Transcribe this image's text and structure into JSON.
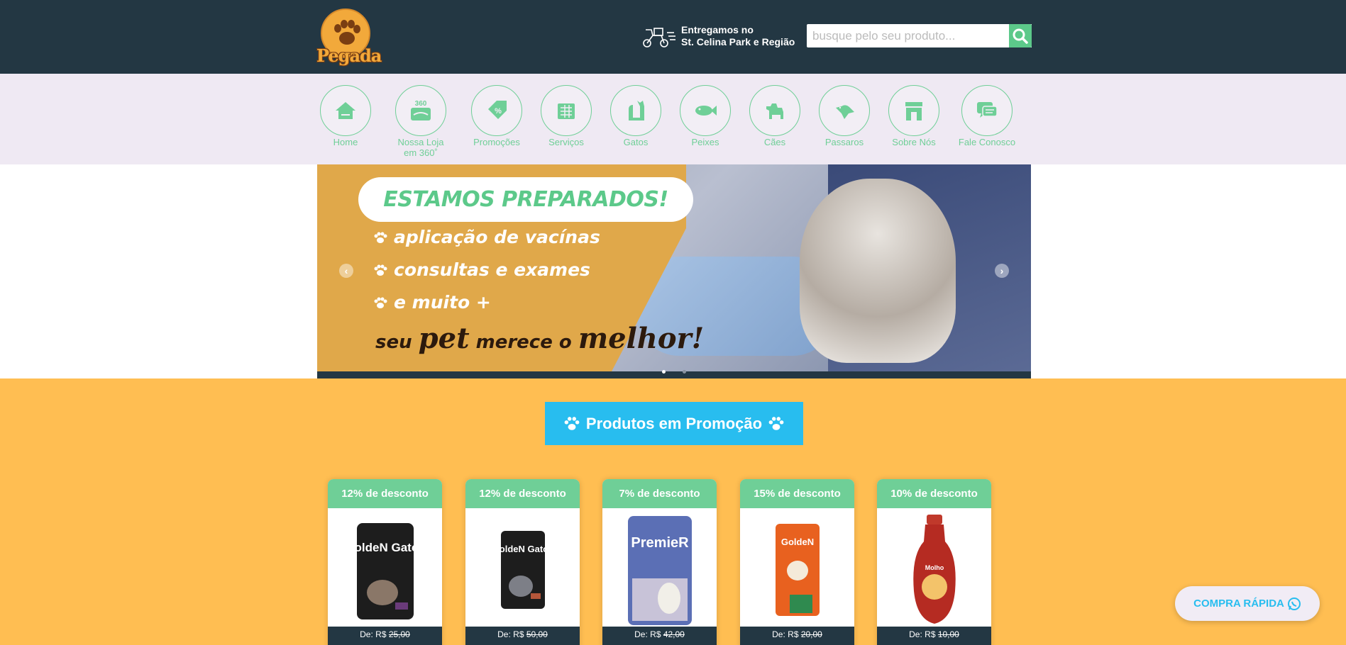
{
  "header": {
    "logo_text": "Pegada",
    "delivery_line1": "Entregamos no",
    "delivery_line2": "St. Celina Park e Região",
    "search_placeholder": "busque pelo seu produto..."
  },
  "nav": {
    "items": [
      {
        "label": "Home",
        "icon": "house-icon"
      },
      {
        "label": "Nossa Loja em 360˚",
        "icon": "store-360-icon"
      },
      {
        "label": "Promoções",
        "icon": "discount-tag-icon"
      },
      {
        "label": "Serviços",
        "icon": "services-icon"
      },
      {
        "label": "Gatos",
        "icon": "cat-icon"
      },
      {
        "label": "Peixes",
        "icon": "fish-icon"
      },
      {
        "label": "Cães",
        "icon": "dog-icon"
      },
      {
        "label": "Passaros",
        "icon": "bird-icon"
      },
      {
        "label": "Sobre Nós",
        "icon": "storefront-icon"
      },
      {
        "label": "Fale Conosco",
        "icon": "chat-icon"
      }
    ]
  },
  "banner": {
    "headline": "ESTAMOS PREPARADOS!",
    "line1": "aplicação de vacínas",
    "line2": "consultas e exames",
    "line3": "e muito +",
    "tag_a": "seu ",
    "tag_b": "pet",
    "tag_c": " merece o ",
    "tag_d": "melhor!",
    "prev_arrow": "‹",
    "next_arrow": "›"
  },
  "promo": {
    "title": "Produtos em Promoção",
    "cards": [
      {
        "discount": "12% de desconto",
        "price_prefix": "De: R$ ",
        "old_price": "25,00",
        "product": "GoldeN Gatos"
      },
      {
        "discount": "12% de desconto",
        "price_prefix": "De: R$ ",
        "old_price": "50,00",
        "product": "GoldeN Gatos"
      },
      {
        "discount": "7% de desconto",
        "price_prefix": "De: R$ ",
        "old_price": "42,00",
        "product": "PremieR"
      },
      {
        "discount": "15% de desconto",
        "price_prefix": "De: R$ ",
        "old_price": "20,00",
        "product": "GoldeN"
      },
      {
        "discount": "10% de desconto",
        "price_prefix": "De: R$ ",
        "old_price": "10,00",
        "product": "Molho"
      }
    ]
  },
  "quick_buy": {
    "label": "COMPRA RÁPIDA"
  },
  "colors": {
    "header_bg": "#233743",
    "nav_bg": "#efe9f3",
    "accent_green": "#6fcf97",
    "promo_bg": "#ffbe52",
    "promo_title_bg": "#28bdef",
    "banner_yellow": "#e0a84a"
  }
}
